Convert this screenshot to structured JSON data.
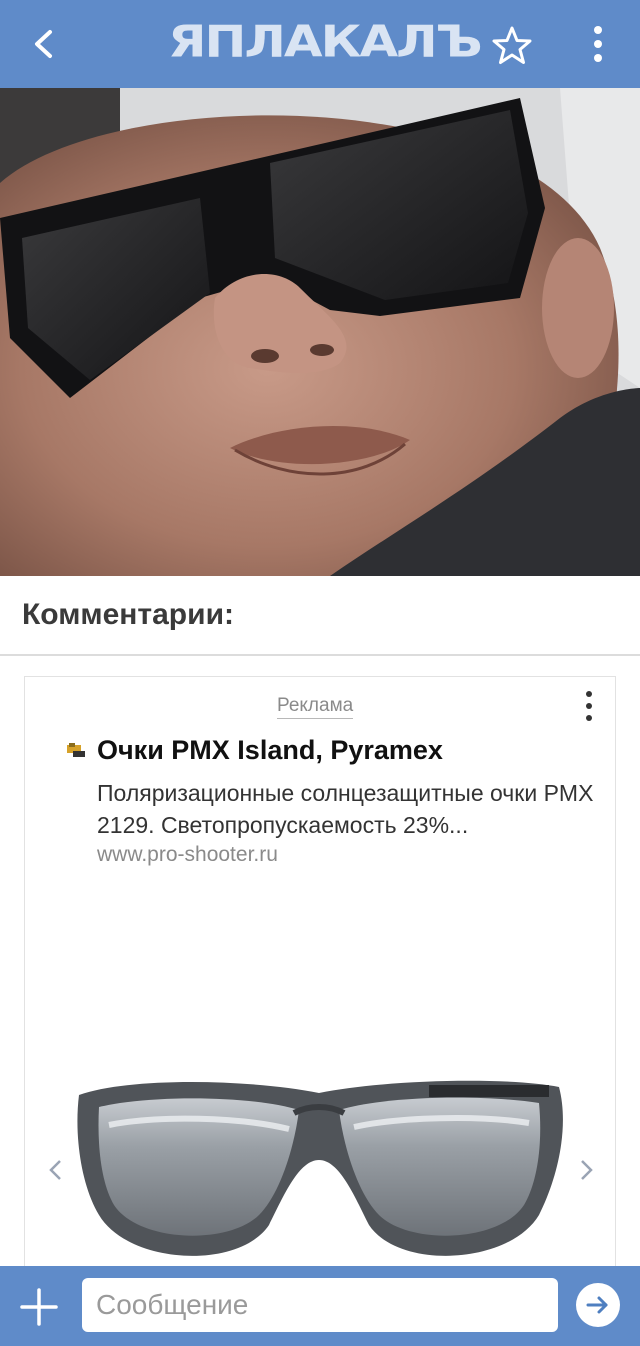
{
  "header": {
    "logo_text": "ЯПЛАКАЛЪ",
    "icons": {
      "back": "back-arrow-icon",
      "favorite": "star-icon",
      "menu": "more-vertical-icon"
    },
    "bar_color": "#5f8bc9"
  },
  "post": {
    "photo_icon": "photo-man-sunglasses"
  },
  "comments": {
    "heading": "Комментарии:"
  },
  "ad": {
    "label": "Реклама",
    "title": "Очки PMX Island, Pyramex",
    "description": "Поляризационные солнцезащитные очки PMX 2129. Светопропускаемость 23%...",
    "url": "www.pro-shooter.ru",
    "image_icon": "sunglasses-product-image",
    "nav_icons": {
      "prev": "chevron-left-icon",
      "next": "chevron-right-icon"
    }
  },
  "composer": {
    "placeholder": "Сообщение",
    "icons": {
      "attach": "plus-icon",
      "send": "arrow-right-icon"
    }
  }
}
